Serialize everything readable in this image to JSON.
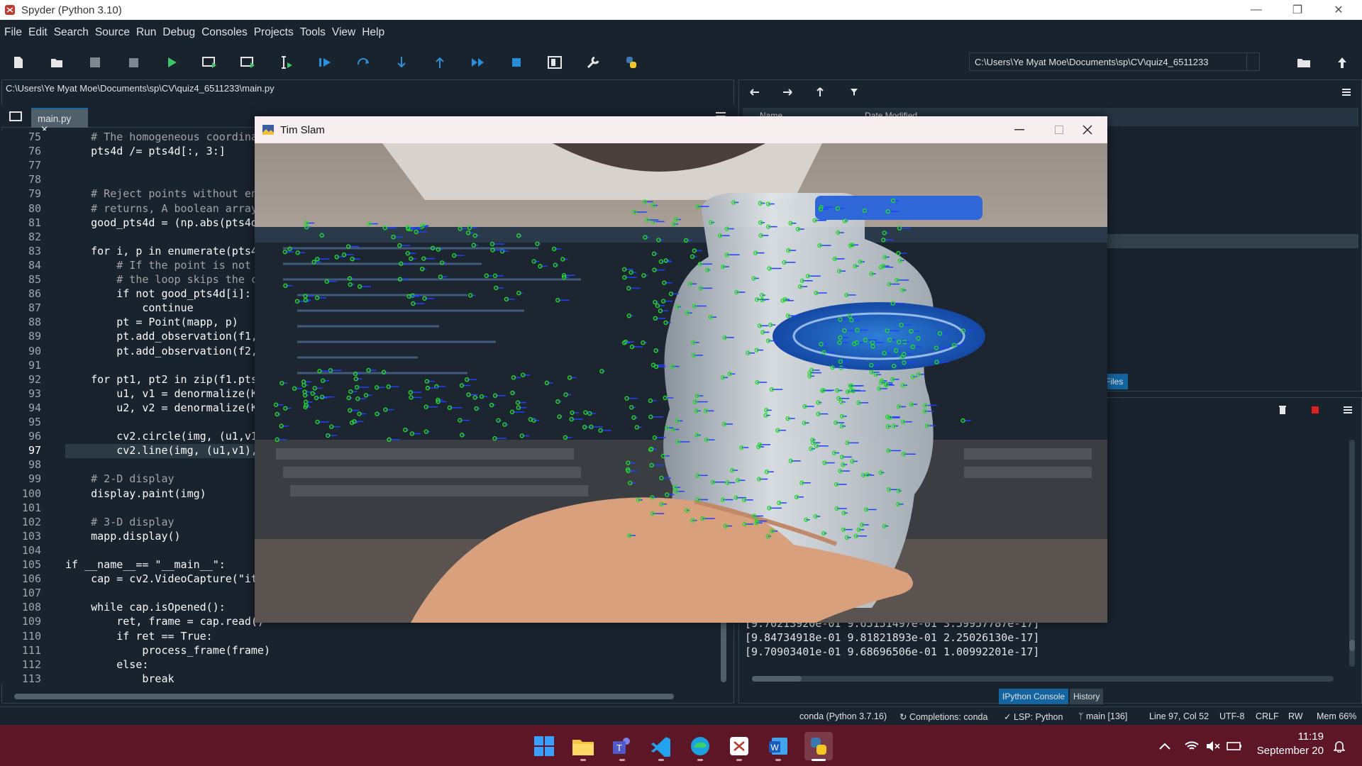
{
  "window": {
    "title": "Spyder (Python 3.10)",
    "minimize": "—",
    "restore": "❐",
    "close": "✕"
  },
  "menu": [
    "File",
    "Edit",
    "Search",
    "Source",
    "Run",
    "Debug",
    "Consoles",
    "Projects",
    "Tools",
    "View",
    "Help"
  ],
  "toolbar": {
    "icons": [
      "new-file-icon",
      "open-file-icon",
      "save-icon",
      "save-all-icon",
      "run-icon",
      "run-cell-icon",
      "run-cell-advance-icon",
      "run-selection-icon",
      "debug-icon",
      "step-icon",
      "step-into-icon",
      "step-return-icon",
      "continue-icon",
      "stop-icon",
      "maximize-pane-icon",
      "preferences-wrench-icon",
      "python-path-icon"
    ],
    "working_dir": "C:\\Users\\Ye Myat Moe\\Documents\\sp\\CV\\quiz4_6511233"
  },
  "editor": {
    "file_path": "C:\\Users\\Ye Myat Moe\\Documents\\sp\\CV\\quiz4_6511233\\main.py",
    "tab_label": "main.py",
    "current_line": 97,
    "lines": [
      {
        "n": "75",
        "text": "    # The homogeneous coordina"
      },
      {
        "n": "76",
        "text": "    pts4d /= pts4d[:, 3:]"
      },
      {
        "n": "77",
        "text": ""
      },
      {
        "n": "78",
        "text": ""
      },
      {
        "n": "79",
        "text": "    # Reject points without en"
      },
      {
        "n": "80",
        "text": "    # returns, A boolean array"
      },
      {
        "n": "81",
        "text": "    good_pts4d = (np.abs(pts4d"
      },
      {
        "n": "82",
        "text": ""
      },
      {
        "n": "83",
        "text": "    for i, p in enumerate(pts4"
      },
      {
        "n": "84",
        "text": "        # If the point is not "
      },
      {
        "n": "85",
        "text": "        # the loop skips the c"
      },
      {
        "n": "86",
        "text": "        if not good_pts4d[i]:"
      },
      {
        "n": "87",
        "text": "            continue"
      },
      {
        "n": "88",
        "text": "        pt = Point(mapp, p)"
      },
      {
        "n": "89",
        "text": "        pt.add_observation(f1,"
      },
      {
        "n": "90",
        "text": "        pt.add_observation(f2,"
      },
      {
        "n": "91",
        "text": ""
      },
      {
        "n": "92",
        "text": "    for pt1, pt2 in zip(f1.pts"
      },
      {
        "n": "93",
        "text": "        u1, v1 = denormalize(K"
      },
      {
        "n": "94",
        "text": "        u2, v2 = denormalize(K"
      },
      {
        "n": "95",
        "text": ""
      },
      {
        "n": "96",
        "text": "        cv2.circle(img, (u1,v1"
      },
      {
        "n": "97",
        "text": "        cv2.line(img, (u1,v1),"
      },
      {
        "n": "98",
        "text": ""
      },
      {
        "n": "99",
        "text": "    # 2-D display"
      },
      {
        "n": "100",
        "text": "    display.paint(img)"
      },
      {
        "n": "101",
        "text": ""
      },
      {
        "n": "102",
        "text": "    # 3-D display"
      },
      {
        "n": "103",
        "text": "    mapp.display()"
      },
      {
        "n": "104",
        "text": ""
      },
      {
        "n": "105",
        "text": "if __name__== \"__main__\":"
      },
      {
        "n": "106",
        "text": "    cap = cv2.VideoCapture(\"it"
      },
      {
        "n": "107",
        "text": ""
      },
      {
        "n": "108",
        "text": "    while cap.isOpened():"
      },
      {
        "n": "109",
        "text": "        ret, frame = cap.read()"
      },
      {
        "n": "110",
        "text": "        if ret == True:"
      },
      {
        "n": "111",
        "text": "            process_frame(frame)"
      },
      {
        "n": "112",
        "text": "        else:"
      },
      {
        "n": "113",
        "text": "            break"
      }
    ]
  },
  "files": {
    "col_name": "Name",
    "col_date": "Date Modified",
    "tab_label": "Files"
  },
  "console": {
    "lines": [
      "[9.70213920e-01 9.65151497e-01 3.59957787e-17]",
      "[9.84734918e-01 9.81821893e-01 2.25026130e-17]",
      "[9.70903401e-01 9.68696506e-01 1.00992201e-17]"
    ],
    "tabs": [
      "IPython Console",
      "History"
    ]
  },
  "status": {
    "env": "conda (Python 3.7.16)",
    "completions": "Completions: conda",
    "lsp": "LSP: Python",
    "git": "main [136]",
    "cursor": "Line 97, Col 52",
    "encoding": "UTF-8",
    "eol": "CRLF",
    "rw": "RW",
    "mem": "Mem 66%"
  },
  "cv_window": {
    "title": "Tim Slam"
  },
  "taskbar": {
    "apps": [
      "windows-start-icon",
      "file-explorer-icon",
      "teams-icon",
      "vscode-icon",
      "edge-icon",
      "spyder-taskbar-icon",
      "word-icon",
      "python-icon"
    ],
    "time": "11:19",
    "date": "September 20"
  },
  "colors": {
    "bg": "#19232d",
    "accent": "#1464a0",
    "taskbar": "#5c1626",
    "feature": "#22dd22",
    "flow": "#2040ff"
  }
}
